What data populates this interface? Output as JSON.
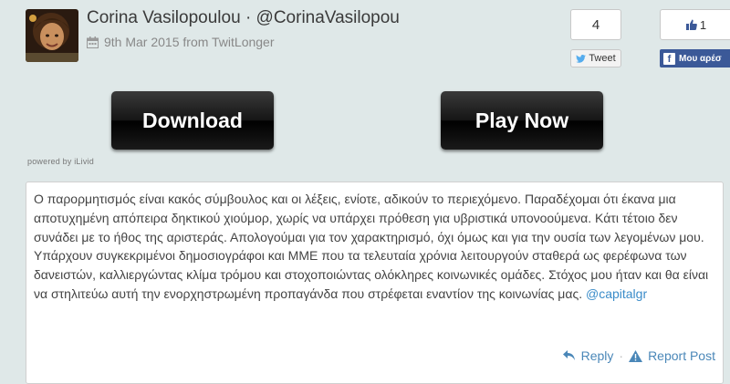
{
  "author": {
    "name": "Corina Vasilopoulou",
    "handle": "@CorinaVasilopou",
    "separator": "·",
    "date": "9th Mar 2015 from TwitLonger"
  },
  "social": {
    "tweet_count": "4",
    "tweet_label": "Tweet",
    "like_count": "1",
    "like_label": "Μου αρέσ"
  },
  "ad": {
    "download_label": "Download",
    "play_label": "Play Now",
    "powered_by": "powered by iLivid"
  },
  "post": {
    "text": "Ο παρορμητισμός είναι κακός σύμβουλος και οι λέξεις, ενίοτε, αδικούν το περιεχόμενο. Παραδέχομαι ότι έκανα μια αποτυχημένη απόπειρα δηκτικού χιούμορ, χωρίς να υπάρχει πρόθεση για υβριστικά υπονοούμενα. Κάτι τέτοιο δεν συνάδει με το ήθος της αριστεράς. Απολογούμαι για τον χαρακτηρισμό, όχι όμως και για την ουσία των λεγομένων μου. Υπάρχουν συγκεκριμένοι δημοσιογράφοι και ΜΜΕ που τα τελευταία χρόνια λειτουργούν σταθερά ως φερέφωνα των δανειστών, καλλιεργώντας κλίμα τρόμου και στοχοποιώντας ολόκληρες κοινωνικές ομάδες. Στόχος μου ήταν και θα είναι να στηλιτεύω αυτή την ενορχηστρωμένη προπαγάνδα που στρέφεται εναντίον της κοινωνίας μας.",
    "mention": "@capitalgr",
    "reply_label": "Reply",
    "report_label": "Report Post"
  },
  "colors": {
    "background": "#dfe8e8",
    "link": "#3a8cc9",
    "facebook": "#3b5998"
  }
}
